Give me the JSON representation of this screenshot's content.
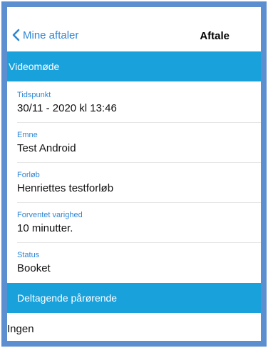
{
  "navbar": {
    "back_label": "Mine aftaler",
    "title": "Aftale"
  },
  "section_video": {
    "title": "Videomøde"
  },
  "fields": [
    {
      "label": "Tidspunkt",
      "value": "30/11 - 2020 kl 13:46"
    },
    {
      "label": "Emne",
      "value": "Test Android"
    },
    {
      "label": "Forløb",
      "value": "Henriettes testforløb"
    },
    {
      "label": "Forventet varighed",
      "value": "10 minutter."
    },
    {
      "label": "Status",
      "value": "Booket"
    }
  ],
  "section_relatives": {
    "title": "Deltagende pårørende",
    "value": "Ingen"
  },
  "colors": {
    "accent": "#19a1dc",
    "link": "#2f86d4",
    "frame": "#5b8fd0"
  },
  "icons": {
    "back": "chevron-left-icon"
  }
}
